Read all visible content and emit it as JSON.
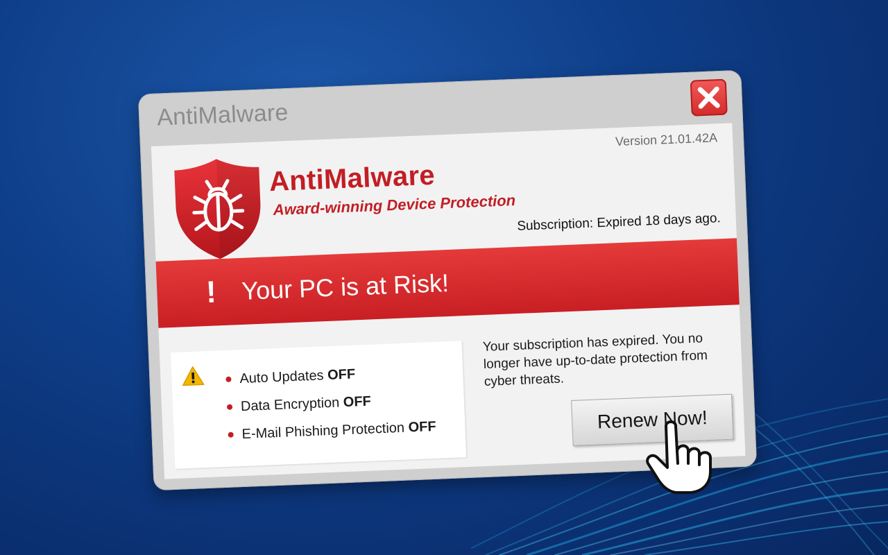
{
  "window": {
    "title": "AntiMalware"
  },
  "app": {
    "version": "Version 21.01.42A",
    "brand_name": "AntiMalware",
    "tagline": "Award-winning Device Protection",
    "subscription_status": "Subscription: Expired 18 days ago."
  },
  "alert": {
    "icon": "exclamation-icon",
    "message": "Your PC is at Risk!"
  },
  "status": {
    "icon": "warning-triangle-icon",
    "items": [
      {
        "label": "Auto Updates",
        "state": "OFF"
      },
      {
        "label": "Data Encryption",
        "state": "OFF"
      },
      {
        "label": "E-Mail Phishing Protection",
        "state": "OFF"
      }
    ]
  },
  "message": "Your subscription has expired. You no longer have up-to-date protection from cyber threats.",
  "renew_button": "Renew Now!",
  "colors": {
    "background": "#0f3f8a",
    "brand_red": "#c21e24",
    "alert_red": "#d9262c",
    "window_frame": "#cfcfcf",
    "panel": "#f2f2f2"
  }
}
